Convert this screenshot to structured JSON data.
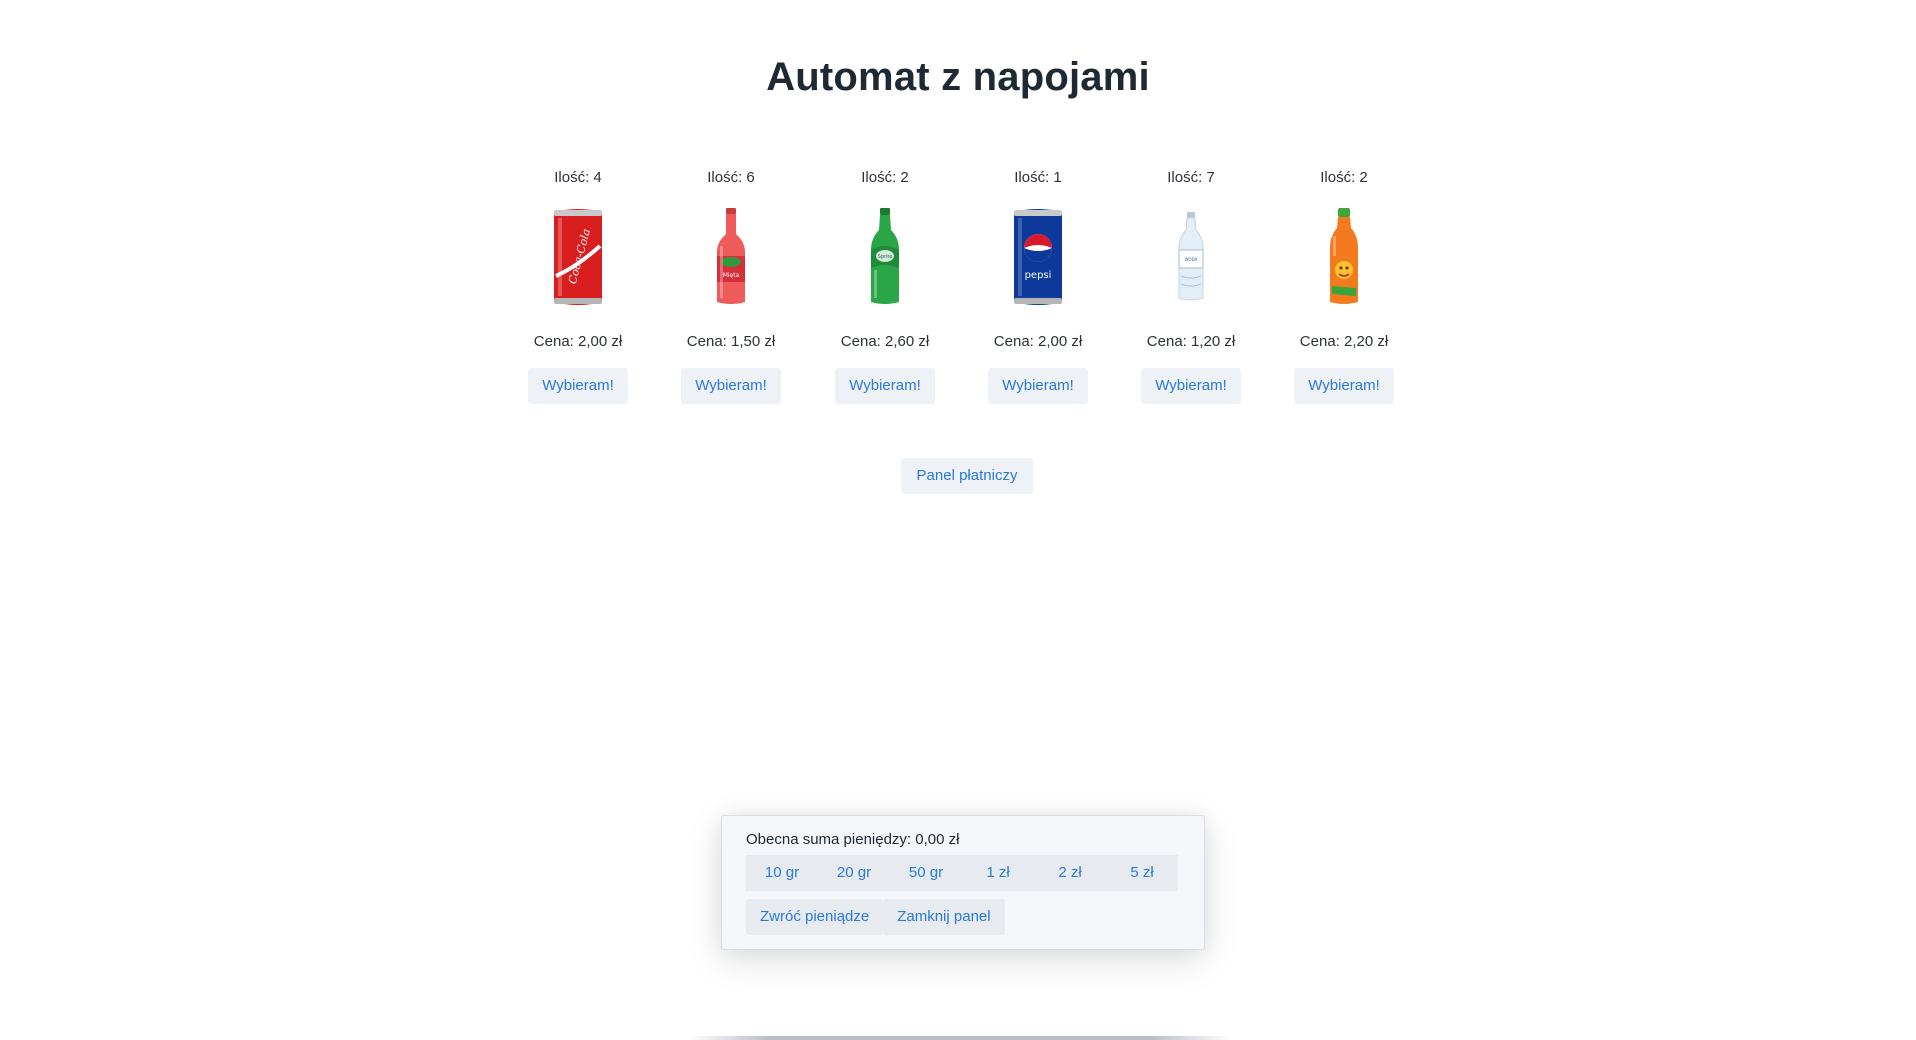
{
  "title": "Automat z napojami",
  "products": [
    {
      "quantity": "Ilość: 4",
      "price": "Cena: 2,00 zł",
      "button": "Wybieram!",
      "icon": "coca-cola-can-icon"
    },
    {
      "quantity": "Ilość: 6",
      "price": "Cena: 1,50 zł",
      "button": "Wybieram!",
      "icon": "red-soda-bottle-icon"
    },
    {
      "quantity": "Ilość: 2",
      "price": "Cena: 2,60 zł",
      "button": "Wybieram!",
      "icon": "sprite-bottle-icon"
    },
    {
      "quantity": "Ilość: 1",
      "price": "Cena: 2,00 zł",
      "button": "Wybieram!",
      "icon": "pepsi-can-icon"
    },
    {
      "quantity": "Ilość: 7",
      "price": "Cena: 1,20 zł",
      "button": "Wybieram!",
      "icon": "water-bottle-icon"
    },
    {
      "quantity": "Ilość: 2",
      "price": "Cena: 2,20 zł",
      "button": "Wybieram!",
      "icon": "orange-juice-bottle-icon"
    }
  ],
  "payment_panel_button": "Panel płatniczy",
  "payment_panel": {
    "current_sum": "Obecna suma pieniędzy: 0,00 zł",
    "coins": [
      "10 gr",
      "20 gr",
      "50 gr",
      "1 zł",
      "2 zł",
      "5 zł"
    ],
    "return_money": "Zwróć pieniądze",
    "close_panel": "Zamknij panel"
  },
  "colors": {
    "accent": "#2979d6",
    "button_bg": "#eef1f5",
    "title": "#1f2933"
  }
}
